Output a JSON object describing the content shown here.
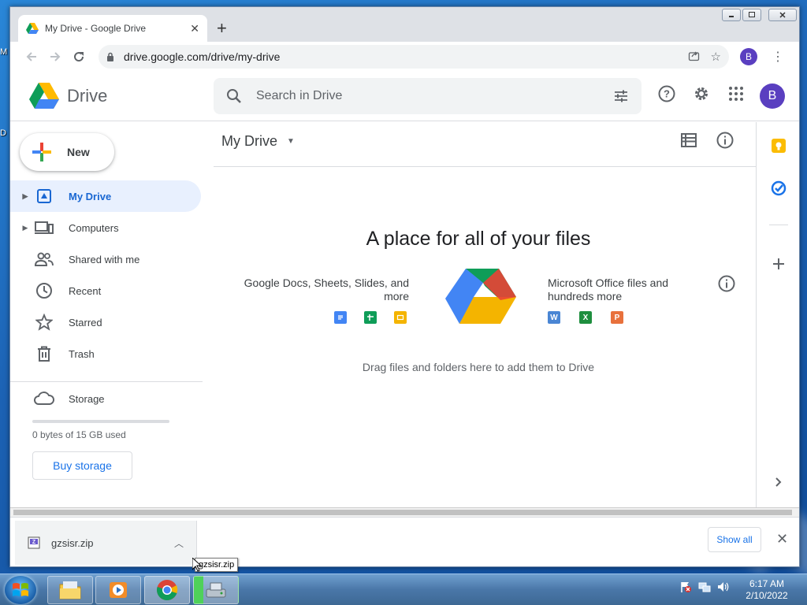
{
  "desktop": {
    "labels": [
      "M",
      "D"
    ]
  },
  "browser": {
    "tab_title": "My Drive - Google Drive",
    "url": "drive.google.com/drive/my-drive",
    "profile_initial": "B"
  },
  "drive": {
    "logo_text": "Drive",
    "search_placeholder": "Search in Drive",
    "avatar_initial": "B",
    "new_label": "New",
    "nav": [
      {
        "label": "My Drive",
        "icon": "drive-icon",
        "active": true
      },
      {
        "label": "Computers",
        "icon": "computers-icon"
      },
      {
        "label": "Shared with me",
        "icon": "people-icon"
      },
      {
        "label": "Recent",
        "icon": "clock-icon"
      },
      {
        "label": "Starred",
        "icon": "star-icon"
      },
      {
        "label": "Trash",
        "icon": "trash-icon"
      },
      {
        "label": "Storage",
        "icon": "cloud-icon"
      }
    ],
    "storage_used": "0 bytes of 15 GB used",
    "buy_storage": "Buy storage",
    "main_title": "My Drive",
    "empty_title": "A place for all of your files",
    "left_text": "Google Docs, Sheets, Slides, and more",
    "right_text": "Microsoft Office files and hundreds more",
    "office_icons": [
      "W",
      "X",
      "P"
    ],
    "drop_text": "Drag files and folders here to add them to Drive"
  },
  "downloads": {
    "file_name": "gzsisr.zip",
    "show_all": "Show all",
    "tooltip": "gzsisr.zip"
  },
  "taskbar": {
    "time": "6:17 AM",
    "date": "2/10/2022"
  },
  "colors": {
    "accent": "#1a73e8",
    "active_bg": "#e8f0fe",
    "avatar": "#5a3fc0"
  }
}
